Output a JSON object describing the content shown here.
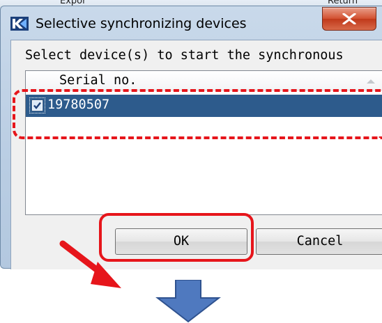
{
  "background": {
    "left_text": "Expor",
    "right_text": "Return"
  },
  "dialog": {
    "title": "Selective synchronizing devices",
    "app_icon": "kestrel-logo-icon",
    "close_icon": "close-x-icon"
  },
  "prompt": "Select device(s) to start the synchronous",
  "list": {
    "column_header": "Serial no.",
    "sort_indicator": "sort-ascending-icon",
    "rows": [
      {
        "serial": "19780507",
        "checked": true,
        "selected": true
      }
    ]
  },
  "buttons": {
    "ok_label": "OK",
    "cancel_label": "Cancel"
  },
  "annotations": {
    "highlight_color": "#e6151b",
    "arrow_down_color": "#4f79bf"
  },
  "colors": {
    "selection": "#2d5b8c",
    "close_button": "#c8432a"
  }
}
